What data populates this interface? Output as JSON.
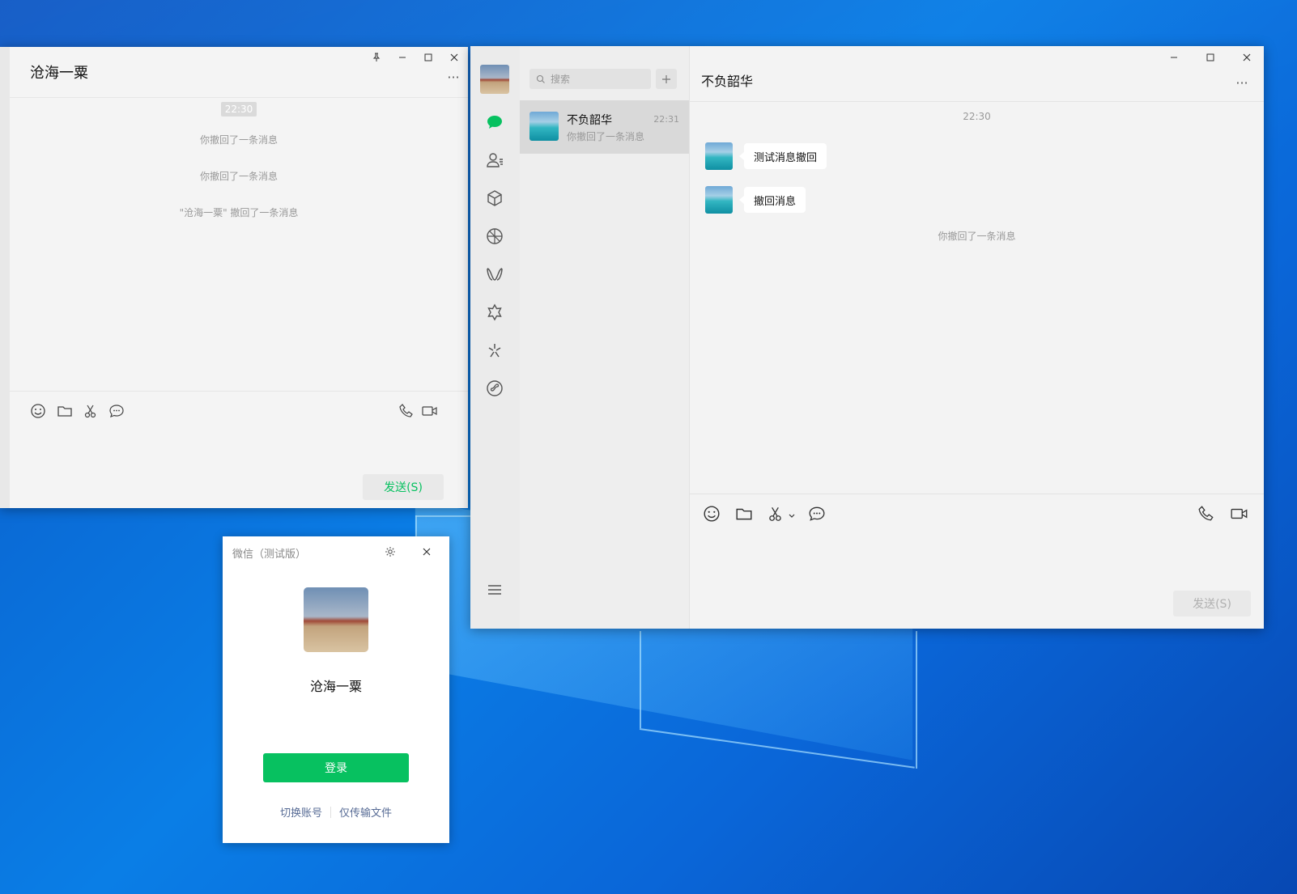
{
  "left_chat": {
    "title": "沧海一粟",
    "timestamp": "22:30",
    "messages": [
      "你撤回了一条消息",
      "你撤回了一条消息",
      "\"沧海一粟\" 撤回了一条消息"
    ],
    "send_label": "发送(S)"
  },
  "main_window": {
    "search_placeholder": "搜索",
    "conversations": [
      {
        "name": "不负韶华",
        "time": "22:31",
        "preview": "你撤回了一条消息"
      }
    ],
    "chat": {
      "title": "不负韶华",
      "timestamp": "22:30",
      "bubbles": [
        "测试消息撤回",
        "撤回消息"
      ],
      "system_message": "你撤回了一条消息",
      "send_label": "发送(S)"
    },
    "rail_icons": [
      "chat-icon",
      "contacts-icon",
      "favorites-icon",
      "moments-icon",
      "channels-icon",
      "search-net-icon",
      "top-stories-icon",
      "mini-program-icon",
      "menu-icon"
    ],
    "accent_color": "#07c160"
  },
  "login_window": {
    "title": "微信（测试版）",
    "username": "沧海一粟",
    "login_label": "登录",
    "switch_account": "切换账号",
    "transfer_only": "仅传输文件",
    "accent_color": "#07c160"
  }
}
